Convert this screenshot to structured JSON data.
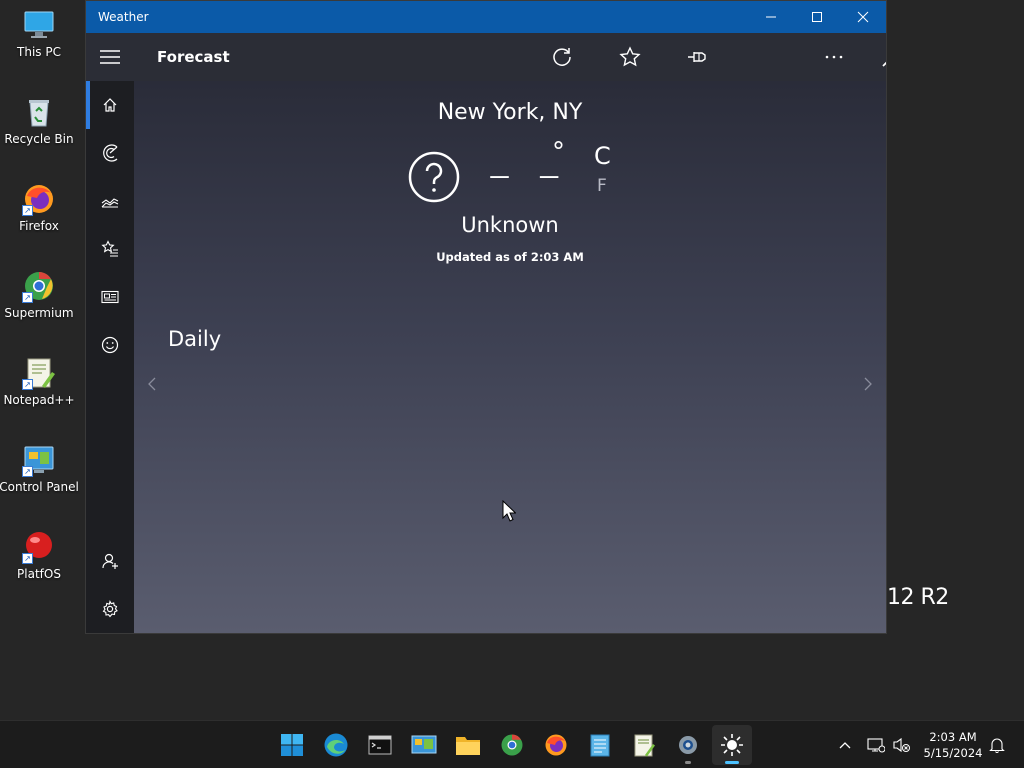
{
  "desktop": {
    "icons": [
      {
        "label": "This PC",
        "icon": "monitor-icon"
      },
      {
        "label": "Recycle Bin",
        "icon": "recycle-bin-icon"
      },
      {
        "label": "Firefox",
        "icon": "firefox-icon"
      },
      {
        "label": "Supermium",
        "icon": "supermium-icon"
      },
      {
        "label": "Notepad++",
        "icon": "notepad-plus-plus-icon"
      },
      {
        "label": "Control Panel",
        "icon": "control-panel-icon"
      },
      {
        "label": "PlatfOS",
        "icon": "platfos-icon"
      }
    ],
    "watermark": "12 R2"
  },
  "window": {
    "title": "Weather",
    "controls": [
      "minimize-icon",
      "maximize-icon",
      "close-icon"
    ],
    "accent": "#0b5aa8"
  },
  "appbar": {
    "title": "Forecast",
    "actions": [
      "refresh-icon",
      "favorite-star-icon",
      "pin-icon",
      "dark-mode-moon-icon",
      "more-icon",
      "search-icon"
    ]
  },
  "nav": {
    "items": [
      "home-icon",
      "radar-icon",
      "historical-chart-icon",
      "favorites-list-icon",
      "news-icon",
      "life-emoji-icon"
    ],
    "bottom": [
      "add-account-icon",
      "settings-gear-icon"
    ],
    "active_index": 0
  },
  "forecast": {
    "location": "New York, NY",
    "temperature": "– –",
    "degree_symbol": "°",
    "unit_celsius": "C",
    "unit_fahrenheit": "F",
    "condition": "Unknown",
    "updated": "Updated as of 2:03 AM",
    "section_title": "Daily"
  },
  "taskbar": {
    "apps": [
      "start-icon",
      "edge-icon",
      "terminal-icon",
      "control-panel-icon",
      "file-explorer-icon",
      "supermium-icon",
      "firefox-icon",
      "notepad-icon",
      "notepad-plus-plus-icon",
      "settings-icon",
      "weather-icon"
    ],
    "tray": [
      "show-hidden-icons-chevron",
      "network-icon",
      "volume-muted-icon"
    ],
    "time": "2:03 AM",
    "date": "5/15/2024",
    "notification": "notification-bell-icon"
  }
}
